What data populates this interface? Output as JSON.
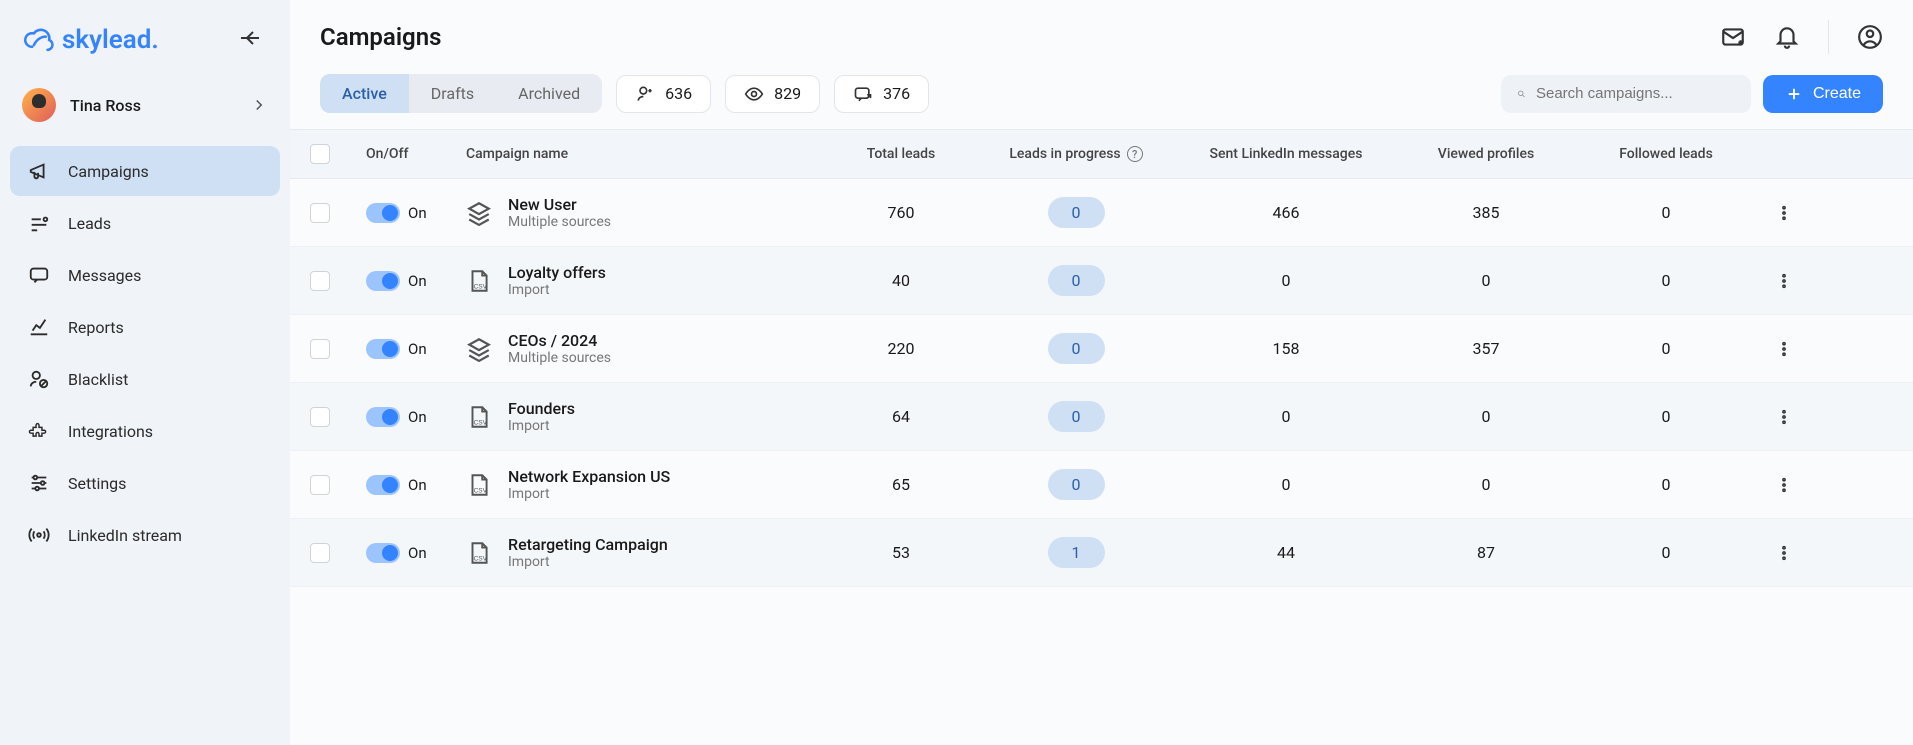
{
  "brand": "skylead.",
  "user": {
    "name": "Tina Ross"
  },
  "sidebar": {
    "items": [
      {
        "label": "Campaigns",
        "active": true,
        "icon": "megaphone"
      },
      {
        "label": "Leads",
        "active": false,
        "icon": "users"
      },
      {
        "label": "Messages",
        "active": false,
        "icon": "message"
      },
      {
        "label": "Reports",
        "active": false,
        "icon": "chart"
      },
      {
        "label": "Blacklist",
        "active": false,
        "icon": "user-block"
      },
      {
        "label": "Integrations",
        "active": false,
        "icon": "puzzle"
      },
      {
        "label": "Settings",
        "active": false,
        "icon": "sliders"
      },
      {
        "label": "LinkedIn stream",
        "active": false,
        "icon": "broadcast"
      }
    ]
  },
  "page": {
    "title": "Campaigns"
  },
  "tabs": [
    {
      "label": "Active",
      "active": true
    },
    {
      "label": "Drafts",
      "active": false
    },
    {
      "label": "Archived",
      "active": false
    }
  ],
  "stats": [
    {
      "icon": "user-plus",
      "value": "636"
    },
    {
      "icon": "eye",
      "value": "829"
    },
    {
      "icon": "message-out",
      "value": "376"
    }
  ],
  "search": {
    "placeholder": "Search campaigns..."
  },
  "create_label": "Create",
  "columns": {
    "onoff": "On/Off",
    "name": "Campaign name",
    "total": "Total leads",
    "progress": "Leads in progress",
    "sent": "Sent LinkedIn messages",
    "viewed": "Viewed profiles",
    "followed": "Followed leads"
  },
  "toggle_on_label": "On",
  "rows": [
    {
      "name": "New User",
      "source": "Multiple sources",
      "icon": "layers",
      "total": "760",
      "progress": "0",
      "sent": "466",
      "viewed": "385",
      "followed": "0"
    },
    {
      "name": "Loyalty offers",
      "source": "Import",
      "icon": "csv",
      "total": "40",
      "progress": "0",
      "sent": "0",
      "viewed": "0",
      "followed": "0"
    },
    {
      "name": "CEOs / 2024",
      "source": "Multiple sources",
      "icon": "layers",
      "total": "220",
      "progress": "0",
      "sent": "158",
      "viewed": "357",
      "followed": "0"
    },
    {
      "name": "Founders",
      "source": "Import",
      "icon": "csv",
      "total": "64",
      "progress": "0",
      "sent": "0",
      "viewed": "0",
      "followed": "0"
    },
    {
      "name": "Network Expansion US",
      "source": "Import",
      "icon": "csv",
      "total": "65",
      "progress": "0",
      "sent": "0",
      "viewed": "0",
      "followed": "0"
    },
    {
      "name": "Retargeting Campaign",
      "source": "Import",
      "icon": "csv",
      "total": "53",
      "progress": "1",
      "sent": "44",
      "viewed": "87",
      "followed": "0"
    }
  ]
}
